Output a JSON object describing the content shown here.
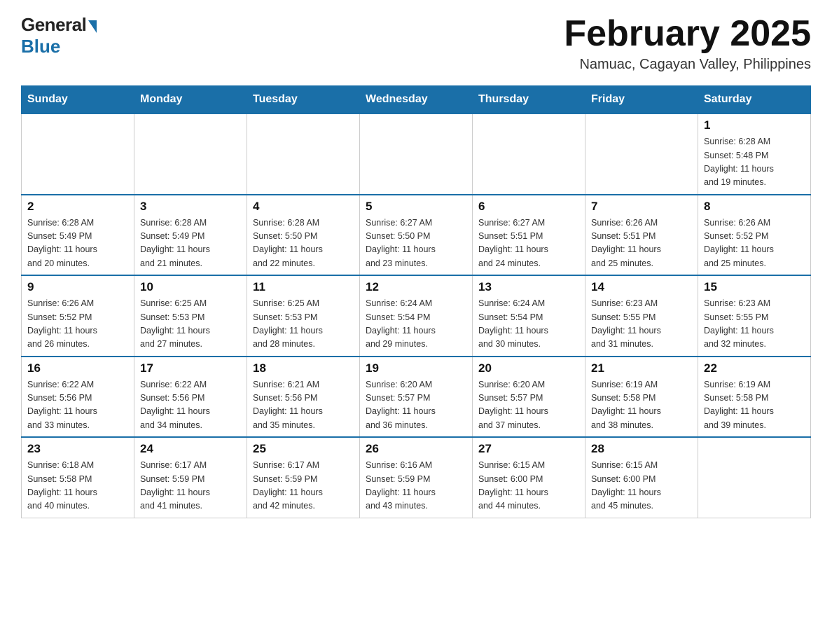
{
  "logo": {
    "general": "General",
    "blue": "Blue"
  },
  "header": {
    "month_year": "February 2025",
    "location": "Namuac, Cagayan Valley, Philippines"
  },
  "weekdays": [
    "Sunday",
    "Monday",
    "Tuesday",
    "Wednesday",
    "Thursday",
    "Friday",
    "Saturday"
  ],
  "weeks": [
    [
      {
        "day": "",
        "info": ""
      },
      {
        "day": "",
        "info": ""
      },
      {
        "day": "",
        "info": ""
      },
      {
        "day": "",
        "info": ""
      },
      {
        "day": "",
        "info": ""
      },
      {
        "day": "",
        "info": ""
      },
      {
        "day": "1",
        "info": "Sunrise: 6:28 AM\nSunset: 5:48 PM\nDaylight: 11 hours\nand 19 minutes."
      }
    ],
    [
      {
        "day": "2",
        "info": "Sunrise: 6:28 AM\nSunset: 5:49 PM\nDaylight: 11 hours\nand 20 minutes."
      },
      {
        "day": "3",
        "info": "Sunrise: 6:28 AM\nSunset: 5:49 PM\nDaylight: 11 hours\nand 21 minutes."
      },
      {
        "day": "4",
        "info": "Sunrise: 6:28 AM\nSunset: 5:50 PM\nDaylight: 11 hours\nand 22 minutes."
      },
      {
        "day": "5",
        "info": "Sunrise: 6:27 AM\nSunset: 5:50 PM\nDaylight: 11 hours\nand 23 minutes."
      },
      {
        "day": "6",
        "info": "Sunrise: 6:27 AM\nSunset: 5:51 PM\nDaylight: 11 hours\nand 24 minutes."
      },
      {
        "day": "7",
        "info": "Sunrise: 6:26 AM\nSunset: 5:51 PM\nDaylight: 11 hours\nand 25 minutes."
      },
      {
        "day": "8",
        "info": "Sunrise: 6:26 AM\nSunset: 5:52 PM\nDaylight: 11 hours\nand 25 minutes."
      }
    ],
    [
      {
        "day": "9",
        "info": "Sunrise: 6:26 AM\nSunset: 5:52 PM\nDaylight: 11 hours\nand 26 minutes."
      },
      {
        "day": "10",
        "info": "Sunrise: 6:25 AM\nSunset: 5:53 PM\nDaylight: 11 hours\nand 27 minutes."
      },
      {
        "day": "11",
        "info": "Sunrise: 6:25 AM\nSunset: 5:53 PM\nDaylight: 11 hours\nand 28 minutes."
      },
      {
        "day": "12",
        "info": "Sunrise: 6:24 AM\nSunset: 5:54 PM\nDaylight: 11 hours\nand 29 minutes."
      },
      {
        "day": "13",
        "info": "Sunrise: 6:24 AM\nSunset: 5:54 PM\nDaylight: 11 hours\nand 30 minutes."
      },
      {
        "day": "14",
        "info": "Sunrise: 6:23 AM\nSunset: 5:55 PM\nDaylight: 11 hours\nand 31 minutes."
      },
      {
        "day": "15",
        "info": "Sunrise: 6:23 AM\nSunset: 5:55 PM\nDaylight: 11 hours\nand 32 minutes."
      }
    ],
    [
      {
        "day": "16",
        "info": "Sunrise: 6:22 AM\nSunset: 5:56 PM\nDaylight: 11 hours\nand 33 minutes."
      },
      {
        "day": "17",
        "info": "Sunrise: 6:22 AM\nSunset: 5:56 PM\nDaylight: 11 hours\nand 34 minutes."
      },
      {
        "day": "18",
        "info": "Sunrise: 6:21 AM\nSunset: 5:56 PM\nDaylight: 11 hours\nand 35 minutes."
      },
      {
        "day": "19",
        "info": "Sunrise: 6:20 AM\nSunset: 5:57 PM\nDaylight: 11 hours\nand 36 minutes."
      },
      {
        "day": "20",
        "info": "Sunrise: 6:20 AM\nSunset: 5:57 PM\nDaylight: 11 hours\nand 37 minutes."
      },
      {
        "day": "21",
        "info": "Sunrise: 6:19 AM\nSunset: 5:58 PM\nDaylight: 11 hours\nand 38 minutes."
      },
      {
        "day": "22",
        "info": "Sunrise: 6:19 AM\nSunset: 5:58 PM\nDaylight: 11 hours\nand 39 minutes."
      }
    ],
    [
      {
        "day": "23",
        "info": "Sunrise: 6:18 AM\nSunset: 5:58 PM\nDaylight: 11 hours\nand 40 minutes."
      },
      {
        "day": "24",
        "info": "Sunrise: 6:17 AM\nSunset: 5:59 PM\nDaylight: 11 hours\nand 41 minutes."
      },
      {
        "day": "25",
        "info": "Sunrise: 6:17 AM\nSunset: 5:59 PM\nDaylight: 11 hours\nand 42 minutes."
      },
      {
        "day": "26",
        "info": "Sunrise: 6:16 AM\nSunset: 5:59 PM\nDaylight: 11 hours\nand 43 minutes."
      },
      {
        "day": "27",
        "info": "Sunrise: 6:15 AM\nSunset: 6:00 PM\nDaylight: 11 hours\nand 44 minutes."
      },
      {
        "day": "28",
        "info": "Sunrise: 6:15 AM\nSunset: 6:00 PM\nDaylight: 11 hours\nand 45 minutes."
      },
      {
        "day": "",
        "info": ""
      }
    ]
  ]
}
